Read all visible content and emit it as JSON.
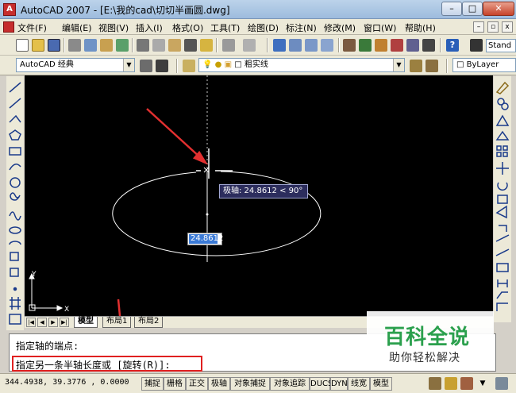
{
  "window": {
    "title": "AutoCAD 2007 - [E:\\我的cad\\切切半画圆.dwg]",
    "min_label": "–",
    "max_label": "□",
    "close_label": "✕"
  },
  "menu": {
    "items": [
      "文件(F)",
      "编辑(E)",
      "视图(V)",
      "插入(I)",
      "格式(O)",
      "工具(T)",
      "绘图(D)",
      "标注(N)",
      "修改(M)",
      "窗口(W)",
      "帮助(H)"
    ]
  },
  "toolbar": {
    "help_label": "?",
    "text_style_value": "Stand"
  },
  "toolbar2": {
    "workspace_value": "AutoCAD 经典",
    "layer_value": "粗实线",
    "color_value": "ByLayer"
  },
  "canvas": {
    "polar_tooltip": "极轴: 24.8612 < 90°",
    "dynamic_input_value": "24.8612",
    "ucs_x_label": "X",
    "ucs_y_label": "Y"
  },
  "tabs": {
    "items": [
      "模型",
      "布局1",
      "布局2"
    ]
  },
  "command": {
    "line1": "指定轴的端点:",
    "line2": "指定另一条半轴长度或 [旋转(R)]:"
  },
  "status": {
    "coords": "344.4938, 39.3776 , 0.0000",
    "buttons": [
      "捕捉",
      "栅格",
      "正交",
      "极轴",
      "对象捕捉",
      "对象追踪",
      "DUCS",
      "DYN",
      "线宽",
      "模型"
    ]
  },
  "watermark": {
    "title": "百科全说",
    "subtitle": "助你轻松解决"
  },
  "colors": {
    "canvas_bg": "#000000",
    "tooltip_bg": "#2c2d5d",
    "annotation_red": "#e02020",
    "watermark_green": "#2ba04d"
  }
}
